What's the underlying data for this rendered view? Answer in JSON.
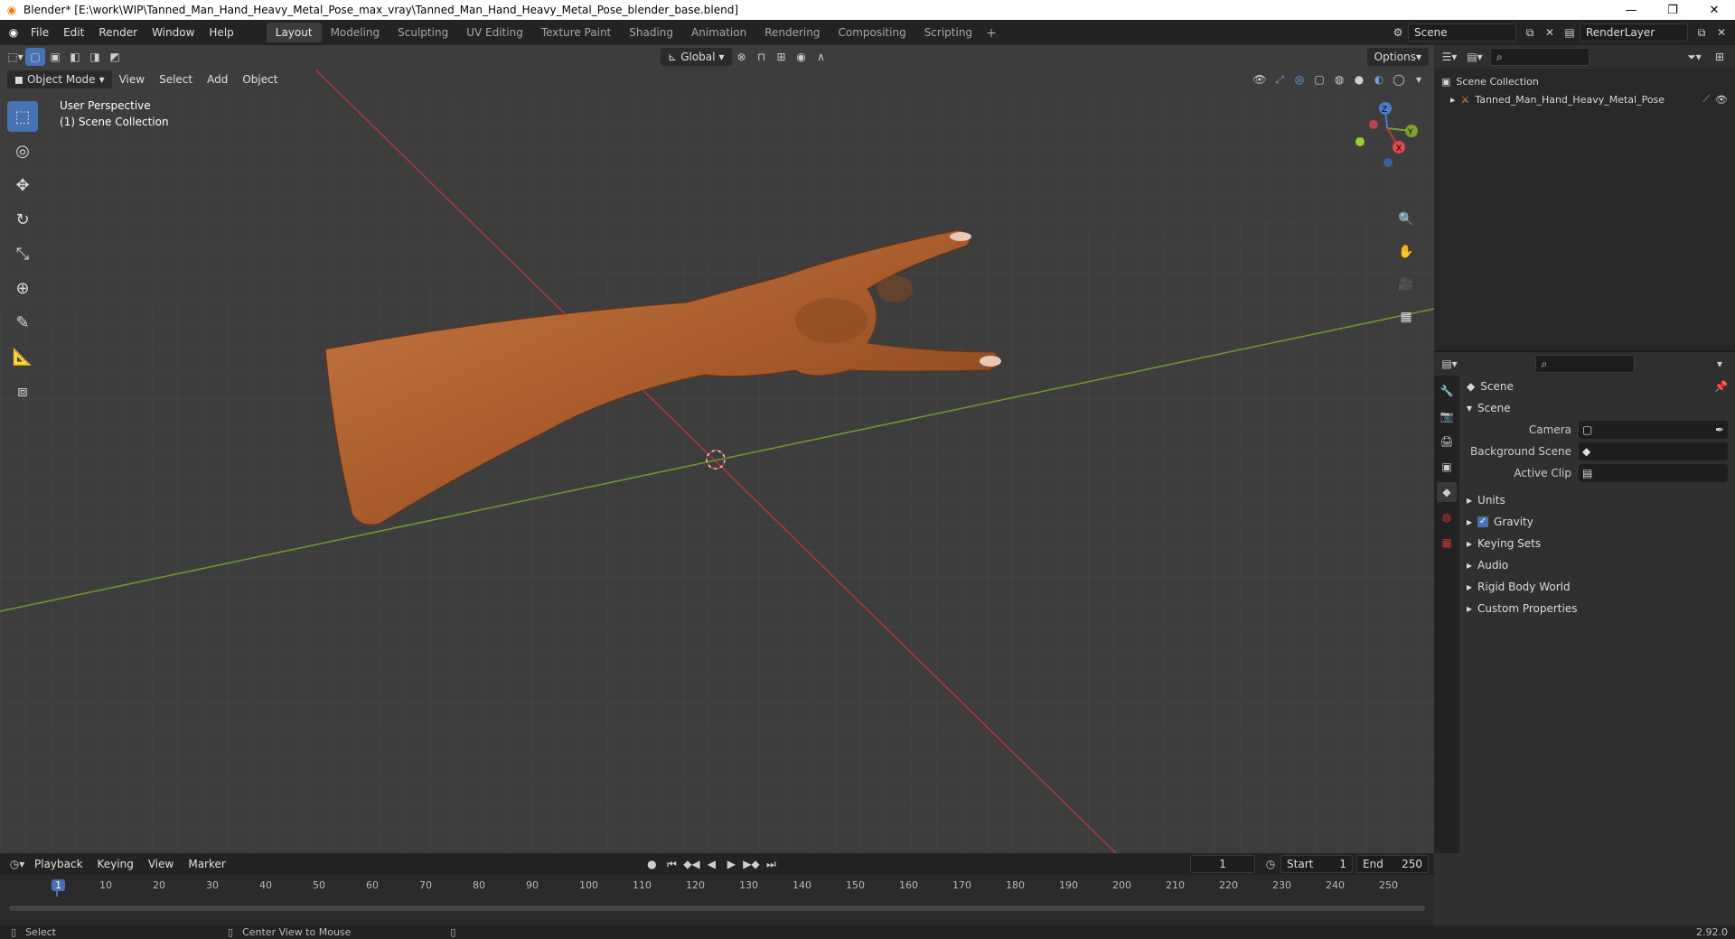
{
  "window": {
    "title": "Blender* [E:\\work\\WIP\\Tanned_Man_Hand_Heavy_Metal_Pose_max_vray\\Tanned_Man_Hand_Heavy_Metal_Pose_blender_base.blend]",
    "minimize": "—",
    "restore": "❐",
    "close": "✕"
  },
  "menu": [
    "File",
    "Edit",
    "Render",
    "Window",
    "Help"
  ],
  "workspaces": [
    "Layout",
    "Modeling",
    "Sculpting",
    "UV Editing",
    "Texture Paint",
    "Shading",
    "Animation",
    "Rendering",
    "Compositing",
    "Scripting"
  ],
  "active_workspace": "Layout",
  "scene_field": "Scene",
  "render_layer_field": "RenderLayer",
  "viewport": {
    "transform_orientation": "Global",
    "options_label": "Options",
    "mode": "Object Mode",
    "header_menus": [
      "View",
      "Select",
      "Add",
      "Object"
    ],
    "perspective_label": "User Perspective",
    "collection_label": "(1) Scene Collection",
    "axis_labels": {
      "x": "X",
      "y": "Y",
      "z": "Z"
    }
  },
  "outliner": {
    "root": "Scene Collection",
    "items": [
      "Tanned_Man_Hand_Heavy_Metal_Pose"
    ]
  },
  "properties": {
    "header": "Scene",
    "section_title": "Scene",
    "rows": [
      {
        "label": "Camera",
        "value": ""
      },
      {
        "label": "Background Scene",
        "value": ""
      },
      {
        "label": "Active Clip",
        "value": ""
      }
    ],
    "sections": [
      "Units",
      "Gravity",
      "Keying Sets",
      "Audio",
      "Rigid Body World",
      "Custom Properties"
    ]
  },
  "timeline": {
    "menus": [
      "Playback",
      "Keying",
      "View",
      "Marker"
    ],
    "current_frame": "1",
    "start_label": "Start",
    "start_value": "1",
    "end_label": "End",
    "end_value": "250",
    "ruler_ticks": [
      "1",
      "10",
      "20",
      "30",
      "40",
      "50",
      "60",
      "70",
      "80",
      "90",
      "100",
      "110",
      "120",
      "130",
      "140",
      "150",
      "160",
      "170",
      "180",
      "190",
      "200",
      "210",
      "220",
      "230",
      "240",
      "250"
    ]
  },
  "status": {
    "left": "Select",
    "middle": "Center View to Mouse",
    "version": "2.92.0"
  }
}
